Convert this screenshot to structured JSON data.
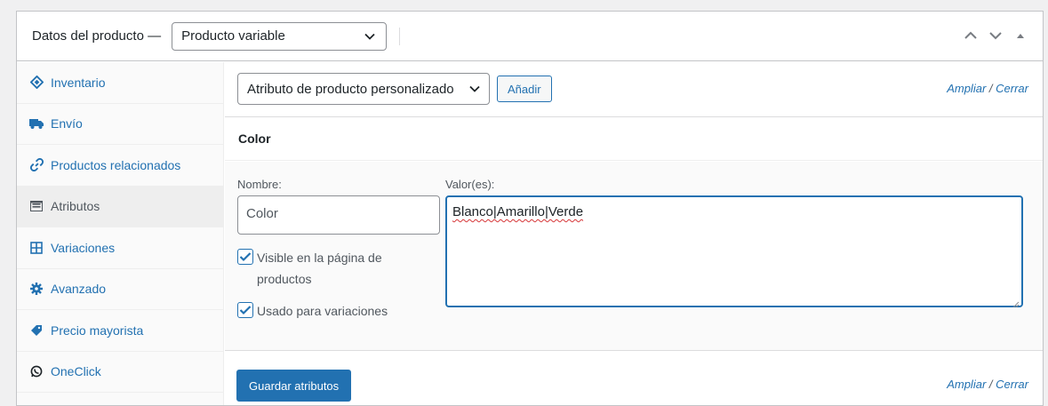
{
  "header": {
    "title": "Datos del producto —",
    "product_type": "Producto variable"
  },
  "sidebar": {
    "items": [
      {
        "label": "Inventario",
        "icon": "tag-icon"
      },
      {
        "label": "Envío",
        "icon": "truck-icon"
      },
      {
        "label": "Productos relacionados",
        "icon": "link-icon"
      },
      {
        "label": "Atributos",
        "icon": "list-icon"
      },
      {
        "label": "Variaciones",
        "icon": "grid-icon"
      },
      {
        "label": "Avanzado",
        "icon": "gear-icon"
      },
      {
        "label": "Precio mayorista",
        "icon": "tag-icon"
      },
      {
        "label": "OneClick",
        "icon": "whatsapp-icon"
      }
    ],
    "active_index": 3
  },
  "toolbar": {
    "attribute_select": "Atributo de producto personalizado",
    "add_label": "Añadir",
    "expand_label": "Ampliar",
    "separator": "/",
    "close_label": "Cerrar"
  },
  "attribute": {
    "heading": "Color",
    "name_label": "Nombre:",
    "name_value": "Color",
    "values_label": "Valor(es):",
    "values_value": "Blanco|Amarillo|Verde",
    "visible_label_line1": "Visible en la página de",
    "visible_label_line2": "productos",
    "visible_checked": true,
    "variations_label": "Usado para variaciones",
    "variations_checked": true
  },
  "footer": {
    "save_label": "Guardar atributos",
    "expand_label": "Ampliar",
    "separator": "/",
    "close_label": "Cerrar"
  },
  "colors": {
    "accent": "#2271b1",
    "text": "#1d2327",
    "muted": "#50575e",
    "spellcheck": "#d63638"
  }
}
